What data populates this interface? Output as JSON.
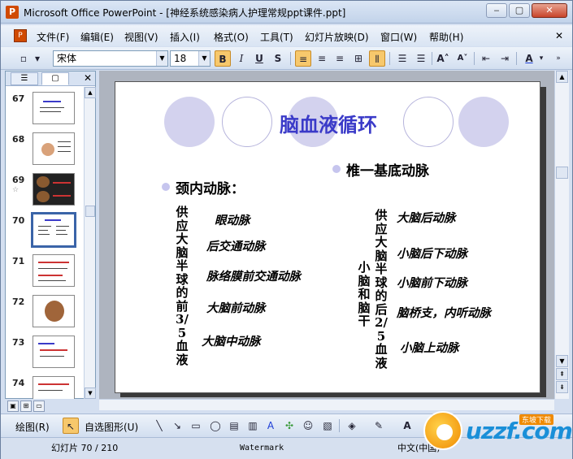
{
  "window": {
    "title": "Microsoft Office PowerPoint - [神经系统感染病人护理常规ppt课件.ppt]",
    "app_icon_letter": "P",
    "min_glyph": "‒",
    "max_glyph": "▢",
    "close_glyph": "✕"
  },
  "menubar": {
    "doc_icon": "P",
    "items": [
      "文件(F)",
      "编辑(E)",
      "视图(V)",
      "插入(I)",
      "格式(O)",
      "工具(T)",
      "幻灯片放映(D)",
      "窗口(W)",
      "帮助(H)"
    ],
    "close_glyph": "✕"
  },
  "toolbar": {
    "font": "宋体",
    "size": "18",
    "bold": "B",
    "italic": "I",
    "underline": "U",
    "shadow": "S",
    "increase_font": "A˄",
    "decrease_font": "A˅",
    "font_color": "A"
  },
  "outline_pane": {
    "close_glyph": "✕",
    "slides": [
      {
        "num": "67",
        "sub": ""
      },
      {
        "num": "68",
        "sub": ""
      },
      {
        "num": "69",
        "sub": "☆"
      },
      {
        "num": "70",
        "sub": "",
        "selected": true
      },
      {
        "num": "71",
        "sub": ""
      },
      {
        "num": "72",
        "sub": ""
      },
      {
        "num": "73",
        "sub": ""
      },
      {
        "num": "74",
        "sub": ""
      }
    ]
  },
  "slide": {
    "title": "脑血液循环",
    "left_heading": "颈内动脉：",
    "right_heading": "椎一基底动脉",
    "left_vertical": "供应大脑半球的前3/5血液",
    "right_vertical": "供应大脑半球的后2/5血液",
    "right_vertical2": "小脑和脑干",
    "left_items": [
      "眼动脉",
      "后交通动脉",
      "脉络膜前交通动脉",
      "大脑前动脉",
      "大脑中动脉"
    ],
    "right_items": [
      "大脑后动脉",
      "小脑后下动脉",
      "小脑前下动脉",
      "脑桥支，内听动脉",
      "小脑上动脉"
    ]
  },
  "drawbar": {
    "draw": "绘图(R)",
    "autoshapes": "自选图形(U)"
  },
  "statusbar": {
    "slide_counter": "幻灯片 70 / 210",
    "design": "Watermark",
    "language": "中文(中国)"
  },
  "watermark": {
    "brand": "uzzf.com",
    "badge": "东坡下载"
  }
}
